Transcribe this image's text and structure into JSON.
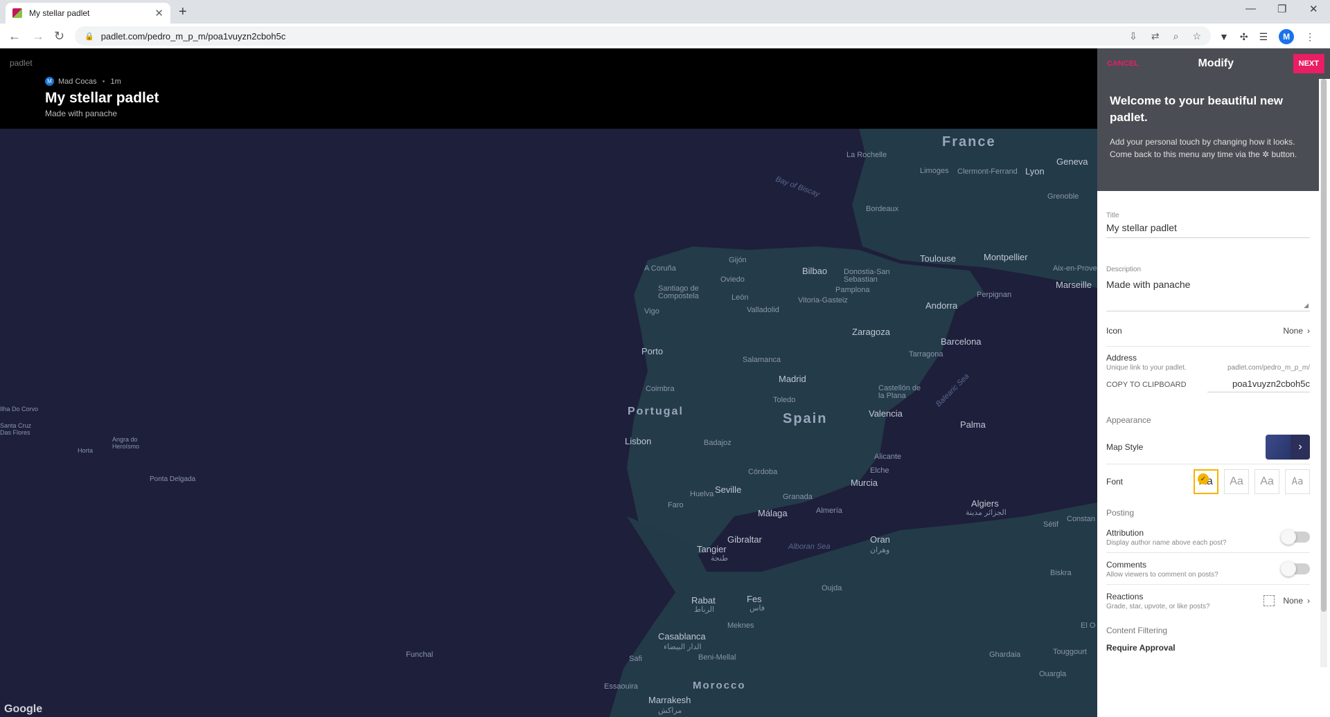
{
  "browser": {
    "tab_title": "My stellar padlet",
    "url": "padlet.com/pedro_m_p_m/poa1vuyzn2cboh5c",
    "profile_initial": "M"
  },
  "header": {
    "brand": "padlet",
    "author_initial": "M",
    "author": "Mad Cocas",
    "age": "1m",
    "title": "My stellar padlet",
    "description": "Made with panache"
  },
  "map": {
    "attribution": "Google",
    "labels": {
      "france": "France",
      "la_rochelle": "La Rochelle",
      "geneva": "Geneva",
      "limoges": "Limoges",
      "clermont": "Clermont-Ferrand",
      "lyon": "Lyon",
      "grenoble": "Grenoble",
      "bay_biscay": "Bay of Biscay",
      "bordeaux": "Bordeaux",
      "toulouse": "Toulouse",
      "montpellier": "Montpellier",
      "aix": "Aix-en-Prove",
      "marseille": "Marseille",
      "gijon": "Gijón",
      "acoruna": "A Coruña",
      "oviedo": "Oviedo",
      "bilbao": "Bilbao",
      "donostia": "Donostia-San Sebastian",
      "santiago": "Santiago de Compostela",
      "pamplona": "Pamplona",
      "vitoria": "Vitoria-Gasteiz",
      "leon": "León",
      "andorra": "Andorra",
      "perpignan": "Perpignan",
      "vigo": "Vigo",
      "valladolid": "Valladolid",
      "zaragoza": "Zaragoza",
      "barcelona": "Barcelona",
      "tarragona": "Tarragona",
      "porto": "Porto",
      "salamanca": "Salamanca",
      "madrid": "Madrid",
      "coimbra": "Coimbra",
      "toledo": "Toledo",
      "castellon": "Castellón de la Plana",
      "balearic": "Balearic Sea",
      "portugal": "Portugal",
      "spain": "Spain",
      "valencia": "Valencia",
      "palma": "Palma",
      "lisbon": "Lisbon",
      "badajoz": "Badajoz",
      "corvo": "Ilha Do Corvo",
      "santa_cruz": "Santa Cruz Das Flores",
      "horta": "Horta",
      "angra": "Angra do Heroísmo",
      "ponta": "Ponta Delgada",
      "alicante": "Alicante",
      "elche": "Elche",
      "cordoba": "Córdoba",
      "murcia": "Murcia",
      "seville": "Seville",
      "huelva": "Huelva",
      "granada": "Granada",
      "malaga": "Málaga",
      "almeria": "Almería",
      "faro": "Faro",
      "algiers": "Algiers",
      "algiers_ar": "الجزائر مدينة",
      "setif": "Sétif",
      "constantine": "Constan",
      "gibraltar": "Gibraltar",
      "alboran": "Alboran Sea",
      "tangier": "Tangier",
      "tangier_ar": "طنجة",
      "oran": "Oran",
      "oran_ar": "وهران",
      "biskra": "Biskra",
      "oujda": "Oujda",
      "rabat": "Rabat",
      "rabat_ar": "الرباط",
      "fes": "Fes",
      "fes_ar": "فاس",
      "meknes": "Meknes",
      "funchal": "Funchal",
      "casablanca": "Casablanca",
      "casablanca_ar": "الدار البيضاء",
      "safi": "Safi",
      "beni_mellal": "Beni-Mellal",
      "ghardaia": "Ghardaia",
      "touggourt": "Touggourt",
      "el_oued": "El O",
      "ouargla": "Ouargla",
      "morocco": "Morocco",
      "essaouira": "Essaouira",
      "marrakesh": "Marrakesh",
      "marrakesh_ar": "مراكش"
    }
  },
  "panel": {
    "cancel": "CANCEL",
    "heading": "Modify",
    "next": "NEXT",
    "welcome_title": "Welcome to your beautiful new padlet.",
    "welcome_text": "Add your personal touch by changing how it looks. Come back to this menu any time via the ✲ button.",
    "title_label": "Title",
    "title_value": "My stellar padlet",
    "description_label": "Description",
    "description_value": "Made with panache",
    "icon_label": "Icon",
    "icon_value": "None",
    "address_label": "Address",
    "address_sub": "Unique link to your padlet.",
    "address_prefix": "padlet.com/pedro_m_p_m/",
    "copy_label": "COPY TO CLIPBOARD",
    "address_slug": "poa1vuyzn2cboh5c",
    "appearance_section": "Appearance",
    "map_style_label": "Map Style",
    "font_label": "Font",
    "font_options": [
      "Aa",
      "Aa",
      "Aa",
      "Aa"
    ],
    "posting_section": "Posting",
    "attribution_label": "Attribution",
    "attribution_sub": "Display author name above each post?",
    "comments_label": "Comments",
    "comments_sub": "Allow viewers to comment on posts?",
    "reactions_label": "Reactions",
    "reactions_sub": "Grade, star, upvote, or like posts?",
    "reactions_value": "None",
    "content_filtering_section": "Content Filtering",
    "require_approval_label": "Require Approval"
  }
}
